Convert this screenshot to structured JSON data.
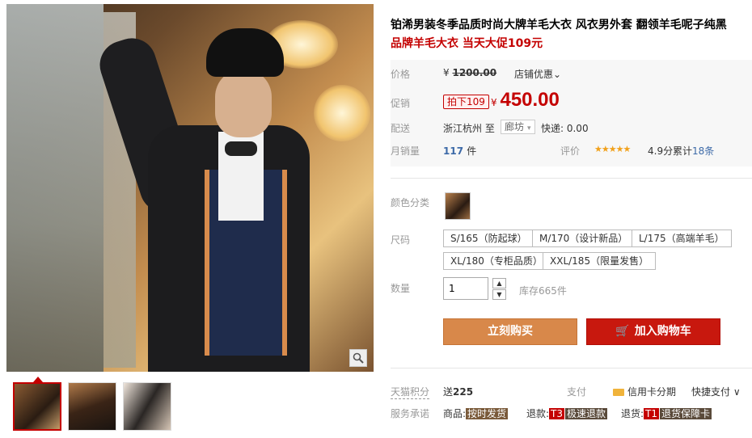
{
  "product": {
    "title": "铂浠男装冬季品质时尚大牌羊毛大衣 风衣男外套 翻领羊毛呢子纯黑",
    "subtitle": "品牌羊毛大衣 当天大促109元"
  },
  "price": {
    "label": "价格",
    "currency": "¥",
    "original": "1200.00",
    "shop_discount": "店铺优惠",
    "shop_discount_chevron": "⌄"
  },
  "promo": {
    "label": "促销",
    "tag": "拍下109",
    "currency": "¥",
    "price": "450.00"
  },
  "shipping": {
    "label": "配送",
    "from": "浙江杭州",
    "to_word": "至",
    "to_city": "廊坊",
    "to_chevron": "▾",
    "express": "快递: 0.00"
  },
  "sales": {
    "label": "月销量",
    "count": "117",
    "unit": "件",
    "rating_label": "评价",
    "rating_stars": 5,
    "stars_text": "★★★★★",
    "score": "4.9分",
    "reviews_prefix": "累计",
    "reviews_count": "18条"
  },
  "options": {
    "color_label": "颜色分类",
    "size_label": "尺码",
    "sizes": [
      "S/165（防起球）",
      "M/170（设计新品）",
      "L/175（高端羊毛）",
      "XL/180（专柜品质）",
      "XXL/185（限量发售）"
    ],
    "qty_label": "数量",
    "qty_value": "1",
    "qty_up": "▲",
    "qty_down": "▼",
    "stock": "库存665件"
  },
  "actions": {
    "buy": "立刻购买",
    "cart": "加入购物车",
    "cart_icon": "🛒"
  },
  "benefits": {
    "points_label": "天猫积分",
    "points_prefix": "送",
    "points": "225",
    "pay_label": "支付",
    "card_pay": "信用卡分期",
    "quick_pay": "快捷支付",
    "quick_pay_chevron": "∨"
  },
  "service": {
    "label": "服务承诺",
    "goods_prefix": "商品:",
    "goods_tag": "按时发货",
    "refund_prefix": "退款:",
    "refund_code": "T3",
    "refund_tag": "极速退款",
    "return_prefix": "退货:",
    "return_code": "T1",
    "return_tag": "退货保障卡"
  },
  "colors": {
    "accent": "#c40000",
    "buy": "#d8884a",
    "cart": "#c8180e"
  }
}
